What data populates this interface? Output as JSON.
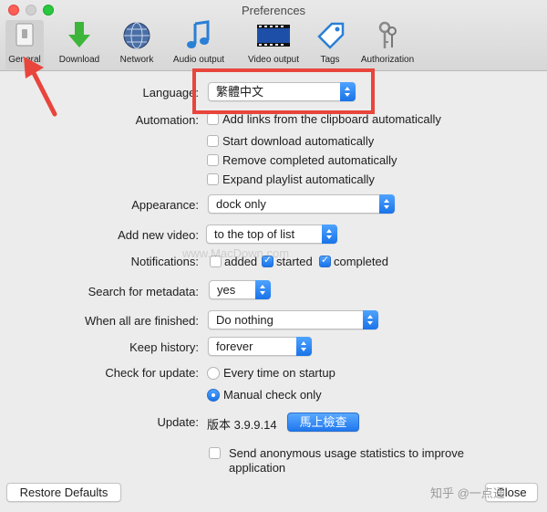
{
  "window": {
    "title": "Preferences"
  },
  "toolbar": {
    "items": [
      {
        "label": "General",
        "icon": "switch-icon",
        "selected": true
      },
      {
        "label": "Download",
        "icon": "download-arrow-icon"
      },
      {
        "label": "Network",
        "icon": "globe-icon"
      },
      {
        "label": "Audio output",
        "icon": "music-note-icon"
      },
      {
        "label": "Video output",
        "icon": "film-strip-icon"
      },
      {
        "label": "Tags",
        "icon": "tag-icon"
      },
      {
        "label": "Authorization",
        "icon": "keys-icon"
      }
    ]
  },
  "form": {
    "language": {
      "label": "Language:",
      "value": "繁體中文"
    },
    "automation": {
      "label": "Automation:",
      "options": [
        {
          "label": "Add links from the clipboard automatically",
          "checked": false
        },
        {
          "label": "Start download automatically",
          "checked": false
        },
        {
          "label": "Remove completed automatically",
          "checked": false
        },
        {
          "label": "Expand playlist automatically",
          "checked": false
        }
      ]
    },
    "appearance": {
      "label": "Appearance:",
      "value": "dock only"
    },
    "add_new_video": {
      "label": "Add new video:",
      "value": "to the top of list"
    },
    "notifications": {
      "label": "Notifications:",
      "options": [
        {
          "label": "added",
          "checked": false
        },
        {
          "label": "started",
          "checked": true
        },
        {
          "label": "completed",
          "checked": true
        }
      ]
    },
    "search_metadata": {
      "label": "Search for metadata:",
      "value": "yes"
    },
    "when_finished": {
      "label": "When all are finished:",
      "value": "Do nothing"
    },
    "keep_history": {
      "label": "Keep history:",
      "value": "forever"
    },
    "check_update": {
      "label": "Check for update:",
      "options": [
        {
          "label": "Every time on startup",
          "selected": false
        },
        {
          "label": "Manual check only",
          "selected": true
        }
      ]
    },
    "update": {
      "label": "Update:",
      "version": "版本 3.9.9.14",
      "button": "馬上檢查"
    },
    "anonymous_stats": {
      "label_line1": "Send anonymous usage statistics to improve",
      "label_line2": "application",
      "checked": false
    }
  },
  "footer": {
    "restore_defaults": "Restore Defaults",
    "close": "Close"
  },
  "overlay": {
    "zhihu_watermark": "知乎 @一点通",
    "site_watermark": "www.MacDown.com"
  },
  "colors": {
    "highlight": "#e8453c",
    "accent": "#1a73e8"
  }
}
